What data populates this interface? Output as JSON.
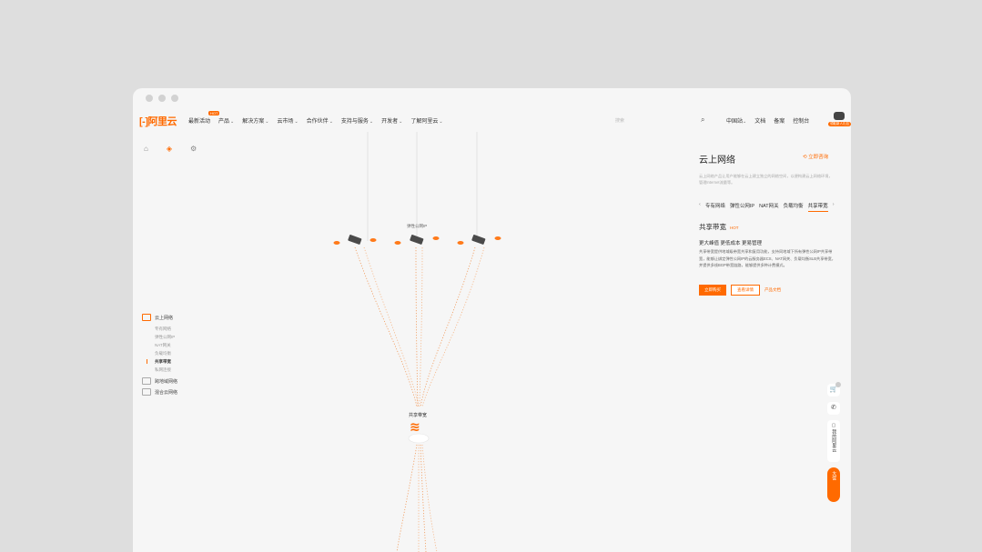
{
  "window": {
    "traffic_lights": [
      "close",
      "minimize",
      "maximize"
    ]
  },
  "header": {
    "logo_text": "阿里云",
    "nav": [
      {
        "label": "最新活动",
        "badge": "HOT",
        "chevron": false
      },
      {
        "label": "产品",
        "chevron": true
      },
      {
        "label": "解决方案",
        "chevron": true
      },
      {
        "label": "云市场",
        "chevron": true
      },
      {
        "label": "合作伙伴",
        "chevron": true
      },
      {
        "label": "支持与服务",
        "chevron": true
      },
      {
        "label": "开发者",
        "chevron": true
      },
      {
        "label": "了解阿里云",
        "chevron": true
      }
    ],
    "search_placeholder": "搜索",
    "right_nav": [
      "中国站",
      "文档",
      "备案",
      "控制台"
    ],
    "region_chevron": true,
    "vip_badge": "领取新人礼包"
  },
  "toolbar": {
    "icons": [
      "home-icon",
      "cube-icon",
      "gear-icon"
    ]
  },
  "left_nav": {
    "groups": [
      {
        "label": "云上网络",
        "active": true,
        "items": [
          {
            "label": "专有网络",
            "active": false
          },
          {
            "label": "弹性公网IP",
            "active": false
          },
          {
            "label": "NAT网关",
            "active": false
          },
          {
            "label": "负载均衡",
            "active": false
          },
          {
            "label": "共享带宽",
            "active": true
          },
          {
            "label": "私网连接",
            "active": false
          }
        ]
      },
      {
        "label": "跨地域网络",
        "active": false,
        "items": []
      },
      {
        "label": "混合云网络",
        "active": false,
        "items": []
      }
    ]
  },
  "diagram": {
    "eip_label": "弹性公网IP",
    "hub_label": "共享带宽"
  },
  "panel": {
    "title": "云上网络",
    "consult": "立即咨询",
    "desc": "云上网络产品让用户能够在云上建立独立的网络空间，以便构建云上网络环境，管理Internet流量等。",
    "tabs": [
      "专有网络",
      "弹性公网IP",
      "NAT网关",
      "负载均衡",
      "共享带宽"
    ],
    "active_tab": "共享带宽",
    "section_title": "共享带宽",
    "section_badge": "HOT",
    "tagline": "更大峰值 更低成本 更易管理",
    "detail": "共享带宽提供地域级带宽共享和复用功能，支持同地域下所有弹性公网IP共享带宽，能够让绑定弹性公网IP的云服务器ECS、NAT网关、负载均衡SLB共享带宽，并提供多线BGP带宽链路，能够提供多种计费模式。",
    "buttons": {
      "buy": "立即购买",
      "detail": "查看详情",
      "docs": "产品文档"
    }
  },
  "float_bar": {
    "cart_icon": "cart-icon",
    "phone_icon": "phone-icon",
    "my_aliyun": "我的阿里云",
    "prize": "大促"
  },
  "colors": {
    "accent": "#ff6a00",
    "bg": "#f6f6f6"
  }
}
